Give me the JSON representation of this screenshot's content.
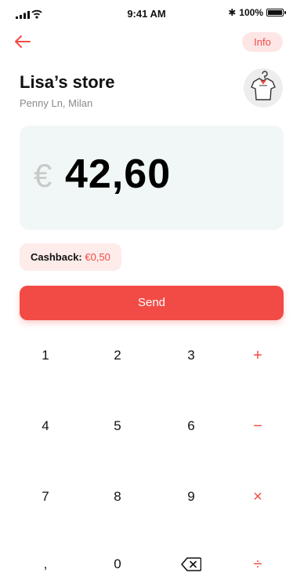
{
  "status_bar": {
    "time": "9:41 AM",
    "battery": "100%"
  },
  "header": {
    "info_label": "Info"
  },
  "store": {
    "name": "Lisa’s store",
    "address": "Penny Ln, Milan"
  },
  "amount": {
    "currency": "€",
    "value": "42,60"
  },
  "cashback": {
    "label": "Cashback:",
    "value": "€0,50"
  },
  "send_label": "Send",
  "keypad": {
    "k1": "1",
    "k2": "2",
    "k3": "3",
    "plus": "+",
    "k4": "4",
    "k5": "5",
    "k6": "6",
    "minus": "−",
    "k7": "7",
    "k8": "8",
    "k9": "9",
    "times": "×",
    "comma": ",",
    "k0": "0",
    "divide": "÷"
  },
  "colors": {
    "accent": "#f24b45",
    "card_bg": "#f1f7f6",
    "chip_bg": "#fdecea"
  }
}
